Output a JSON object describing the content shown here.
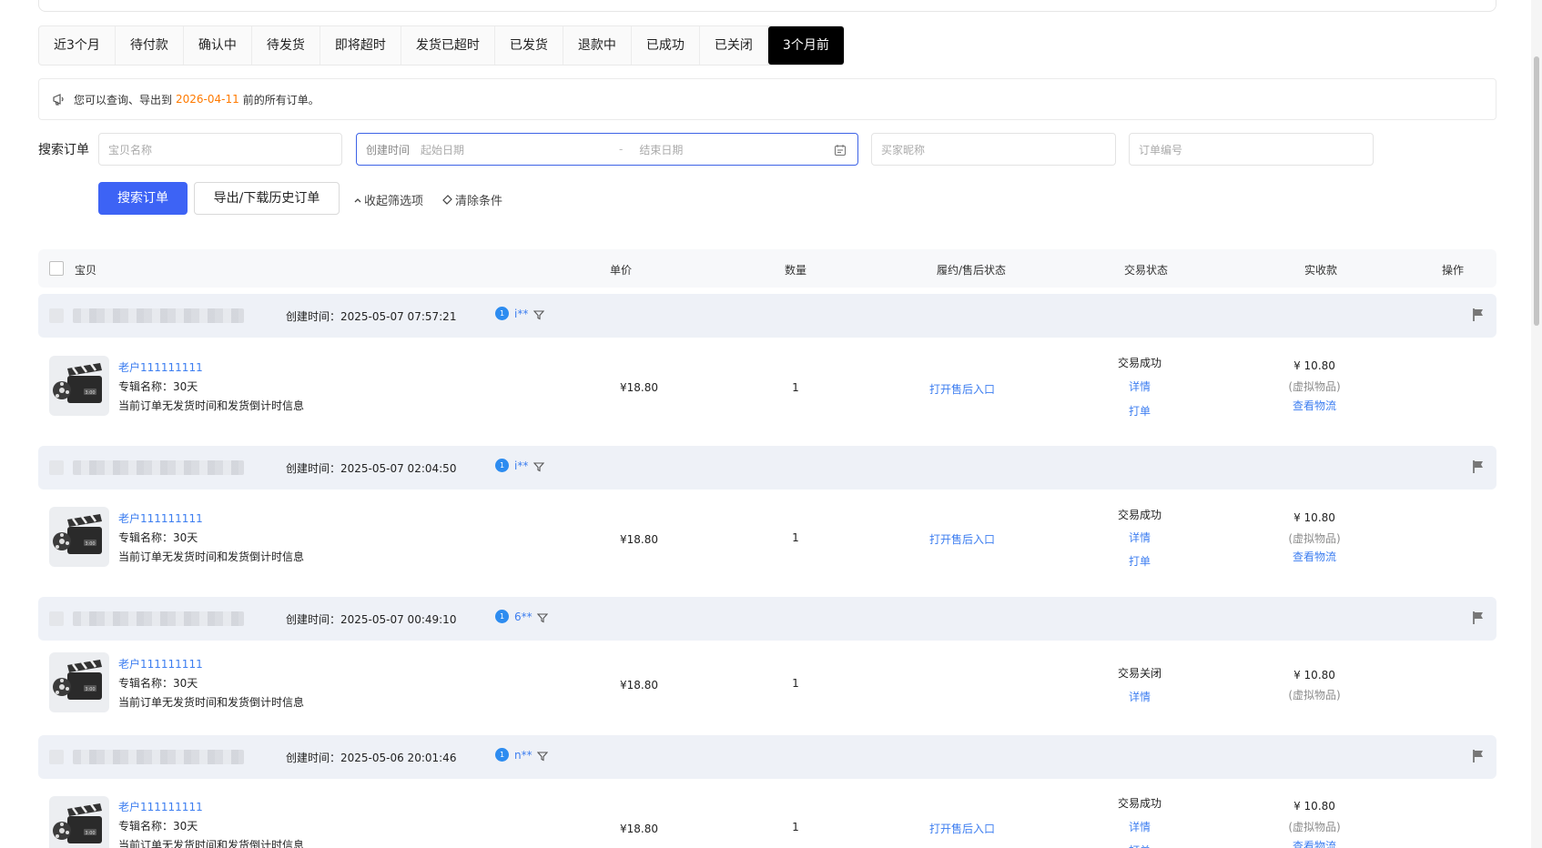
{
  "tabs": [
    "近3个月",
    "待付款",
    "确认中",
    "待发货",
    "即将超时",
    "发货已超时",
    "已发货",
    "退款中",
    "已成功",
    "已关闭",
    "3个月前"
  ],
  "active_tab_index": 10,
  "notice": {
    "prefix": "您可以查询、导出到",
    "date": "2026-04-11",
    "suffix": "前的所有订单。"
  },
  "search": {
    "label": "搜索订单",
    "item_name_placeholder": "宝贝名称",
    "created_time_label": "创建时间",
    "start_date_placeholder": "起始日期",
    "date_separator": "-",
    "end_date_placeholder": "结束日期",
    "buyer_nickname_placeholder": "买家昵称",
    "order_no_placeholder": "订单编号"
  },
  "actions": {
    "search_button": "搜索订单",
    "export_button": "导出/下载历史订单",
    "collapse_link": "收起筛选项",
    "clear_link": "清除条件"
  },
  "table_header": {
    "item": "宝贝",
    "unit_price": "单价",
    "quantity": "数量",
    "fulfillment": "履约/售后状态",
    "trade_status": "交易状态",
    "received": "实收款",
    "operation": "操作"
  },
  "orders": [
    {
      "created": "创建时间：2025-05-07 07:57:21",
      "buyer": "i**",
      "title": "老户111111111",
      "album": "专辑名称：30天",
      "note": "当前订单无发货时间和发货倒计时信息",
      "price": "¥18.80",
      "qty": "1",
      "after_sale": "打开售后入口",
      "status": "交易成功",
      "detail": "详情",
      "print": "打单",
      "received": "¥ 10.80",
      "virtual": "(虚拟物品)",
      "logistics": "查看物流"
    },
    {
      "created": "创建时间：2025-05-07 02:04:50",
      "buyer": "i**",
      "title": "老户111111111",
      "album": "专辑名称：30天",
      "note": "当前订单无发货时间和发货倒计时信息",
      "price": "¥18.80",
      "qty": "1",
      "after_sale": "打开售后入口",
      "status": "交易成功",
      "detail": "详情",
      "print": "打单",
      "received": "¥ 10.80",
      "virtual": "(虚拟物品)",
      "logistics": "查看物流"
    },
    {
      "created": "创建时间：2025-05-07 00:49:10",
      "buyer": "6**",
      "title": "老户111111111",
      "album": "专辑名称：30天",
      "note": "当前订单无发货时间和发货倒计时信息",
      "price": "¥18.80",
      "qty": "1",
      "after_sale": "",
      "status": "交易关闭",
      "detail": "详情",
      "print": "",
      "received": "¥ 10.80",
      "virtual": "(虚拟物品)",
      "logistics": ""
    },
    {
      "created": "创建时间：2025-05-06 20:01:46",
      "buyer": "n**",
      "title": "老户111111111",
      "album": "专辑名称：30天",
      "note": "当前订单无发货时间和发货倒计时信息",
      "price": "¥18.80",
      "qty": "1",
      "after_sale": "打开售后入口",
      "status": "交易成功",
      "detail": "详情",
      "print": "打单",
      "received": "¥ 10.80",
      "virtual": "(虚拟物品)",
      "logistics": "查看物流"
    }
  ],
  "colors": {
    "accent": "#3d63f5",
    "link": "#3d7ef0",
    "date_highlight": "#ff7a00",
    "active_tab": "#000000"
  },
  "icons": [
    "megaphone-icon",
    "calendar-icon",
    "chevron-up-icon",
    "eraser-icon",
    "filter-icon",
    "flag-icon",
    "buyer-badge-icon",
    "clapperboard-icon"
  ]
}
